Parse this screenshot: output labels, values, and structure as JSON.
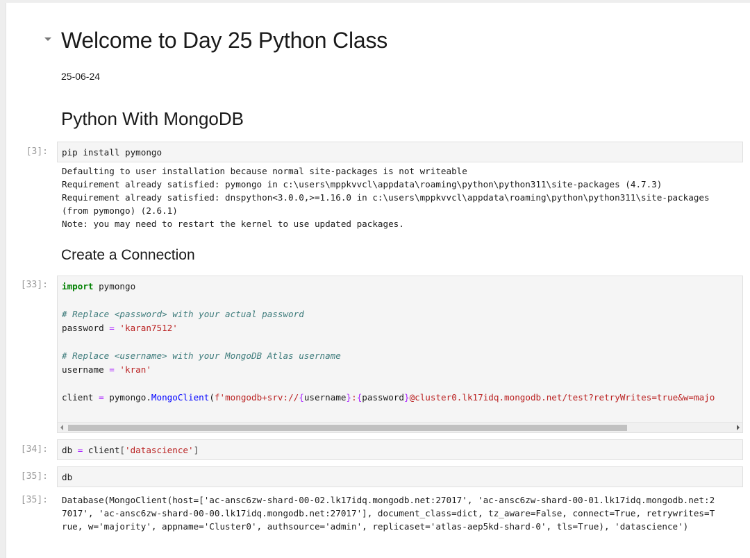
{
  "title": "Welcome to Day 25 Python Class",
  "date": "25-06-24",
  "heading_mongodb": "Python With MongoDB",
  "heading_connection": "Create a Connection",
  "cells": {
    "c1": {
      "prompt": "[3]:",
      "code": "pip install pymongo",
      "output": "Defaulting to user installation because normal site-packages is not writeable\nRequirement already satisfied: pymongo in c:\\users\\mppkvvcl\\appdata\\roaming\\python\\python311\\site-packages (4.7.3)\nRequirement already satisfied: dnspython<3.0.0,>=1.16.0 in c:\\users\\mppkvvcl\\appdata\\roaming\\python\\python311\\site-packages\n(from pymongo) (2.6.1)\nNote: you may need to restart the kernel to use updated packages."
    },
    "c2": {
      "prompt": "[33]:",
      "kw_import": "import",
      "mod": " pymongo",
      "comment1": "# Replace <password> with your actual password",
      "pw_var": "password ",
      "pw_eq": "=",
      "pw_val": " 'karan7512'",
      "comment2": "# Replace <username> with your MongoDB Atlas username",
      "user_var": "username ",
      "user_eq": "=",
      "user_val": " 'kran'",
      "client_var": "client ",
      "client_eq": "=",
      "client_mid": " pymongo.",
      "client_fn": "MongoClient",
      "client_p1": "(",
      "client_s1": "f'mongodb+srv://",
      "client_b1": "{",
      "client_u": "username",
      "client_b2": "}",
      "client_s2": ":",
      "client_b3": "{",
      "client_p": "password",
      "client_b4": "}",
      "client_s3": "@cluster0.lk17idq.mongodb.net/test?retryWrites=true&w=majo"
    },
    "c3": {
      "prompt": "[34]:",
      "var": "db ",
      "eq": "=",
      "mid": " client",
      "p1": "[",
      "val": "'datascience'",
      "p2": "]"
    },
    "c4": {
      "prompt": "[35]:",
      "code": "db",
      "out_prompt": "[35]:",
      "output": "Database(MongoClient(host=['ac-ansc6zw-shard-00-02.lk17idq.mongodb.net:27017', 'ac-ansc6zw-shard-00-01.lk17idq.mongodb.net:2\n7017', 'ac-ansc6zw-shard-00-00.lk17idq.mongodb.net:27017'], document_class=dict, tz_aware=False, connect=True, retrywrites=T\nrue, w='majority', appname='Cluster0', authsource='admin', replicaset='atlas-aep5kd-shard-0', tls=True), 'datascience')"
    }
  }
}
